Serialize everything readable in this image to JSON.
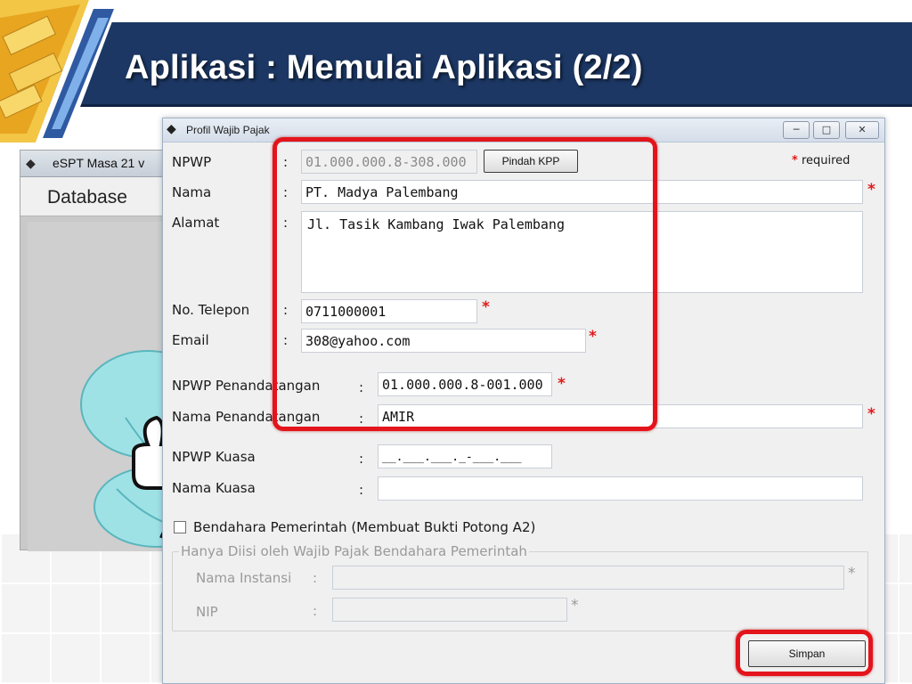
{
  "slide": {
    "title": "Aplikasi : Memulai Aplikasi (2/2)"
  },
  "background_window": {
    "title": "eSPT Masa 21 v",
    "menu_item": "Database"
  },
  "dialog": {
    "title": "Profil Wajib Pajak",
    "required_note": "required",
    "required_star": "*",
    "fields": {
      "npwp": {
        "label": "NPWP",
        "value": "01.000.000.8-308.000"
      },
      "nama": {
        "label": "Nama",
        "value": "PT. Madya Palembang"
      },
      "alamat": {
        "label": "Alamat",
        "value": "Jl. Tasik Kambang Iwak Palembang"
      },
      "telepon": {
        "label": "No. Telepon",
        "value": "0711000001"
      },
      "email": {
        "label": "Email",
        "value": "308@yahoo.com"
      },
      "npwp_penandatangan": {
        "label": "NPWP Penandatangan",
        "value": "01.000.000.8-001.000"
      },
      "nama_penandatangan": {
        "label": "Nama Penandatangan",
        "value": "AMIR"
      },
      "npwp_kuasa": {
        "label": "NPWP Kuasa",
        "value": "__.___.___._-___.___"
      },
      "nama_kuasa": {
        "label": "Nama Kuasa",
        "value": ""
      },
      "nama_instansi": {
        "label": "Nama Instansi",
        "value": ""
      },
      "nip": {
        "label": "NIP",
        "value": ""
      }
    },
    "colon": ":",
    "pindah_kpp_label": "Pindah KPP",
    "checkbox_bendahara_label": "Bendahara Pemerintah (Membuat Bukti Potong A2)",
    "checkbox_bendahara_checked": false,
    "group_label": "Hanya Diisi oleh Wajib Pajak Bendahara Pemerintah",
    "simpan_label": "Simpan"
  },
  "colors": {
    "title_bar": "#1c3763",
    "highlight": "#e3141b",
    "required": "#e11a1a"
  }
}
